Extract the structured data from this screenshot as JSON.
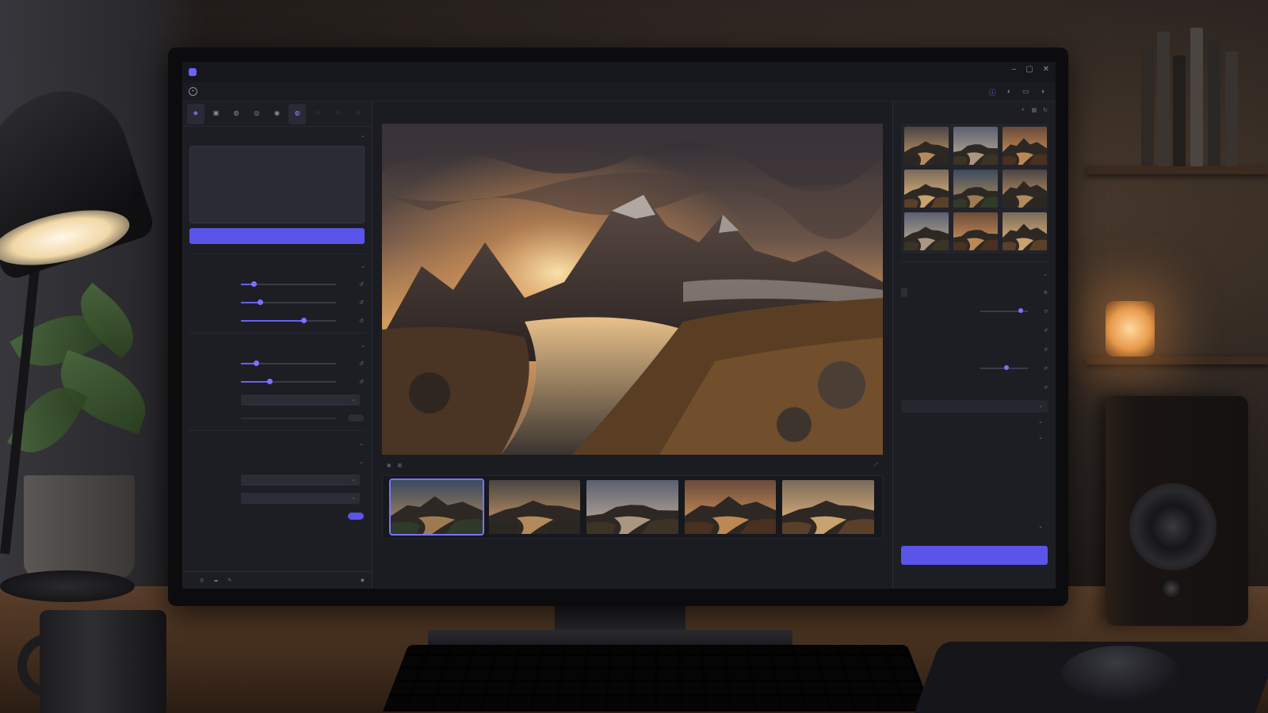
{
  "app": {
    "title": "",
    "window_controls": [
      "–",
      "▢",
      "✕"
    ]
  },
  "toolbar": {
    "tools": [
      {
        "icon": "generate-icon",
        "glyph": "◈",
        "caption": "",
        "active": true
      },
      {
        "icon": "image-icon",
        "glyph": "▣",
        "caption": ""
      },
      {
        "icon": "edit-icon",
        "glyph": "◍",
        "caption": ""
      },
      {
        "icon": "mask-icon",
        "glyph": "◎",
        "caption": ""
      },
      {
        "icon": "upscale-icon",
        "glyph": "◉",
        "caption": ""
      },
      {
        "icon": "style-icon",
        "glyph": "◍",
        "caption": "",
        "active": true
      },
      {
        "icon": "history-icon",
        "glyph": "◌",
        "caption": ""
      },
      {
        "icon": "export-icon",
        "glyph": "◌",
        "caption": ""
      },
      {
        "icon": "settings-icon",
        "glyph": "◌",
        "caption": ""
      }
    ]
  },
  "left_panel": {
    "prompt_section_title": "",
    "generate_label": "",
    "settings_section_title": "",
    "sliders_a": [
      {
        "label": "",
        "value": 0.13
      },
      {
        "label": "",
        "value": 0.2
      },
      {
        "label": "",
        "value": 0.66
      }
    ],
    "advanced_section_title": "",
    "sliders_b": [
      {
        "label": "",
        "value": 0.16
      },
      {
        "label": "",
        "value": 0.3
      }
    ],
    "dropdowns": [
      {
        "label": "",
        "value": ""
      },
      {
        "label": "",
        "value": ""
      },
      {
        "label": "",
        "value": ""
      },
      {
        "label": "",
        "value": ""
      },
      {
        "label": "",
        "value": ""
      }
    ],
    "status": [
      "",
      "",
      "",
      ""
    ]
  },
  "canvas": {
    "zoom_text": "",
    "footer_buttons": [
      "",
      ""
    ]
  },
  "filmstrip": {
    "count": 5,
    "selected_index": 0
  },
  "right_panel": {
    "gallery_title": "",
    "gallery_captions": [
      "",
      "",
      "",
      "",
      "",
      "",
      "",
      "",
      ""
    ],
    "props_title": "",
    "tag_value": "",
    "props": [
      {
        "label": "",
        "slider": 0.85
      },
      {
        "label": ""
      },
      {
        "label": ""
      },
      {
        "label": "",
        "slider": 0.55
      },
      {
        "label": ""
      }
    ],
    "dropdowns": [
      "",
      "",
      "",
      ""
    ],
    "action_label": ""
  },
  "colors": {
    "accent": "#5b54e8",
    "panel_bg": "#1d1e24",
    "screen_bg": "#1b1c22"
  }
}
